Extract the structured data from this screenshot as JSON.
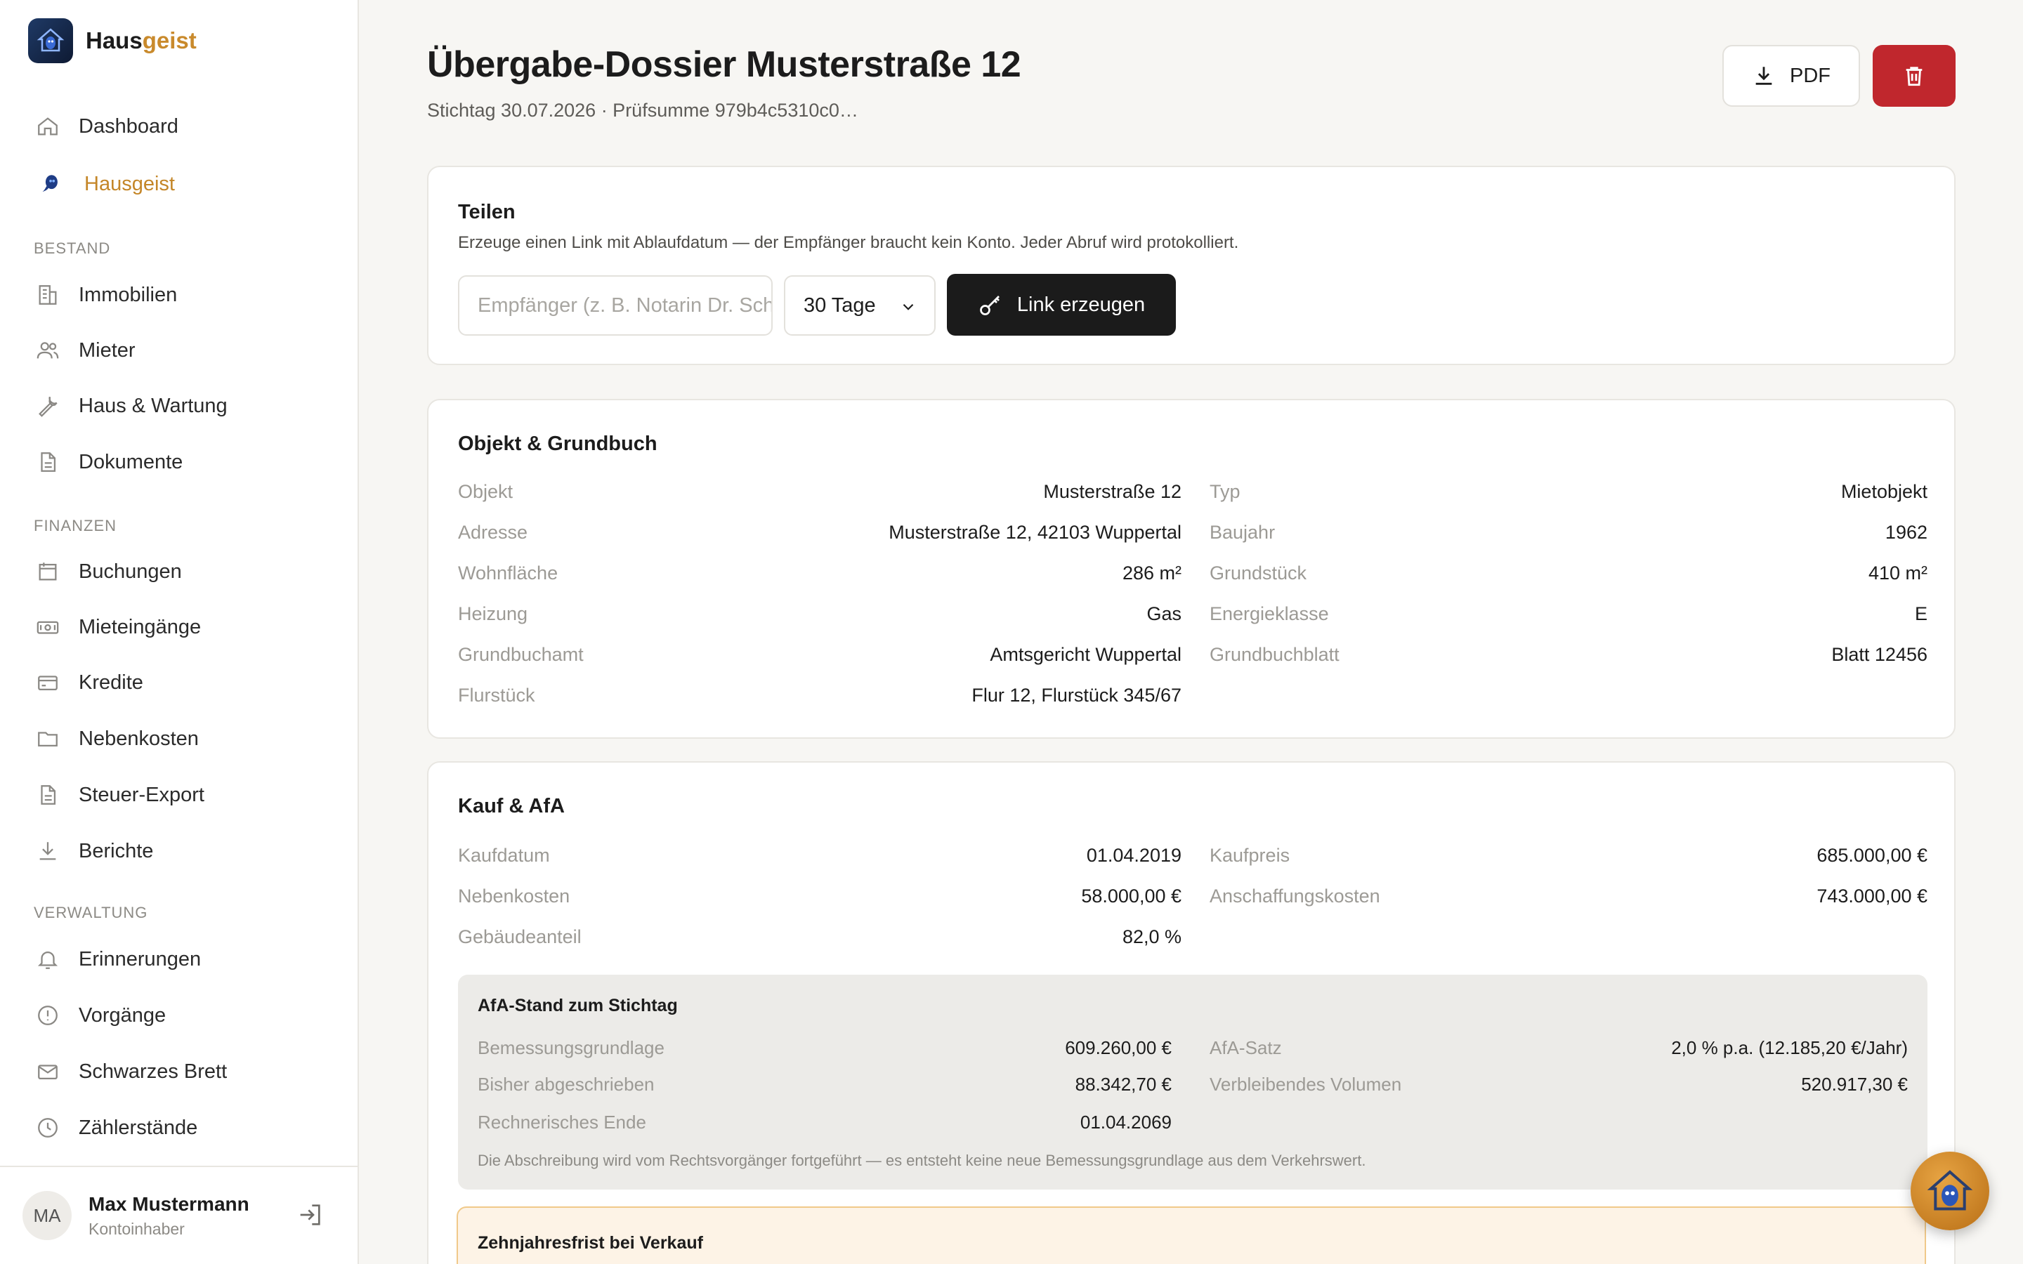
{
  "brand": {
    "name_main": "Haus",
    "name_accent": "geist"
  },
  "nav": {
    "top": [
      {
        "label": "Dashboard",
        "icon": "home-icon"
      },
      {
        "label": "Hausgeist",
        "icon": "hausgeist-icon",
        "active": true
      }
    ],
    "sections": [
      {
        "label": "BESTAND",
        "items": [
          {
            "label": "Immobilien",
            "icon": "building-icon"
          },
          {
            "label": "Mieter",
            "icon": "users-icon"
          },
          {
            "label": "Haus & Wartung",
            "icon": "wrench-icon"
          },
          {
            "label": "Dokumente",
            "icon": "document-icon"
          }
        ]
      },
      {
        "label": "FINANZEN",
        "items": [
          {
            "label": "Buchungen",
            "icon": "ledger-icon"
          },
          {
            "label": "Mieteingänge",
            "icon": "banknote-icon"
          },
          {
            "label": "Kredite",
            "icon": "credit-card-icon"
          },
          {
            "label": "Nebenkosten",
            "icon": "folder-icon"
          },
          {
            "label": "Steuer-Export",
            "icon": "file-icon"
          },
          {
            "label": "Berichte",
            "icon": "download-icon"
          }
        ]
      },
      {
        "label": "VERWALTUNG",
        "items": [
          {
            "label": "Erinnerungen",
            "icon": "bell-icon"
          },
          {
            "label": "Vorgänge",
            "icon": "alert-circle-icon"
          },
          {
            "label": "Schwarzes Brett",
            "icon": "mail-icon"
          },
          {
            "label": "Zählerstände",
            "icon": "clock-icon"
          }
        ]
      }
    ]
  },
  "user": {
    "initials": "MA",
    "name": "Max Mustermann",
    "role": "Kontoinhaber"
  },
  "header": {
    "title": "Übergabe-Dossier Musterstraße 12",
    "subtitle": "Stichtag 30.07.2026 · Prüfsumme 979b4c5310c0…",
    "pdf_label": "PDF"
  },
  "share": {
    "title": "Teilen",
    "description": "Erzeuge einen Link mit Ablaufdatum — der Empfänger braucht kein Konto. Jeder Abruf wird protokolliert.",
    "recipient_placeholder": "Empfänger (z. B. Notarin Dr. Schmidt)",
    "duration": "30 Tage",
    "button": "Link erzeugen"
  },
  "objekt": {
    "title": "Objekt & Grundbuch",
    "left": [
      {
        "label": "Objekt",
        "value": "Musterstraße 12"
      },
      {
        "label": "Adresse",
        "value": "Musterstraße 12, 42103 Wuppertal"
      },
      {
        "label": "Wohnfläche",
        "value": "286 m²"
      },
      {
        "label": "Heizung",
        "value": "Gas"
      },
      {
        "label": "Grundbuchamt",
        "value": "Amtsgericht Wuppertal"
      },
      {
        "label": "Flurstück",
        "value": "Flur 12, Flurstück 345/67"
      }
    ],
    "right": [
      {
        "label": "Typ",
        "value": "Mietobjekt"
      },
      {
        "label": "Baujahr",
        "value": "1962"
      },
      {
        "label": "Grundstück",
        "value": "410 m²"
      },
      {
        "label": "Energieklasse",
        "value": "E"
      },
      {
        "label": "Grundbuchblatt",
        "value": "Blatt 12456"
      }
    ]
  },
  "kauf": {
    "title": "Kauf & AfA",
    "left": [
      {
        "label": "Kaufdatum",
        "value": "01.04.2019"
      },
      {
        "label": "Nebenkosten",
        "value": "58.000,00 €"
      },
      {
        "label": "Gebäudeanteil",
        "value": "82,0 %"
      }
    ],
    "right": [
      {
        "label": "Kaufpreis",
        "value": "685.000,00 €"
      },
      {
        "label": "Anschaffungskosten",
        "value": "743.000,00 €"
      }
    ],
    "afa": {
      "title": "AfA-Stand zum Stichtag",
      "left": [
        {
          "label": "Bemessungsgrundlage",
          "value": "609.260,00 €"
        },
        {
          "label": "Bisher abgeschrieben",
          "value": "88.342,70 €"
        },
        {
          "label": "Rechnerisches Ende",
          "value": "01.04.2069"
        }
      ],
      "right": [
        {
          "label": "AfA-Satz",
          "value": "2,0 % p.a. (12.185,20 €/Jahr)"
        },
        {
          "label": "Verbleibendes Volumen",
          "value": "520.917,30 €"
        }
      ],
      "note": "Die Abschreibung wird vom Rechtsvorgänger fortgeführt — es entsteht keine neue Bemessungsgrundlage aus dem Verkehrswert."
    }
  },
  "frist": {
    "title": "Zehnjahresfrist bei Verkauf"
  },
  "colors": {
    "accent": "#c98a2c",
    "danger": "#c0272d",
    "dark_button": "#1b1b1b"
  }
}
